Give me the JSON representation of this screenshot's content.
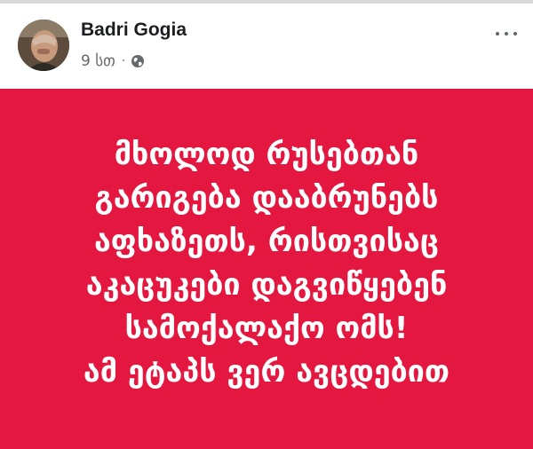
{
  "post": {
    "author": "Badri Gogia",
    "time": "9 სთ",
    "separator": "·",
    "privacy_icon": "globe-icon",
    "more_icon": "more-options-icon",
    "lines": [
      "მხოლოდ რუსებთან",
      "გარიგება დააბრუნებს",
      "აფხაზეთს, რისთვისაც",
      "აკაცუკები დაგვიწყებენ",
      "სამოქალაქო ომს!",
      "ამ ეტაპს ვერ ავცდებით"
    ]
  },
  "colors": {
    "background": "#e3173f",
    "text": "#ffffff",
    "author": "#1c1e21",
    "meta": "#65676b"
  }
}
